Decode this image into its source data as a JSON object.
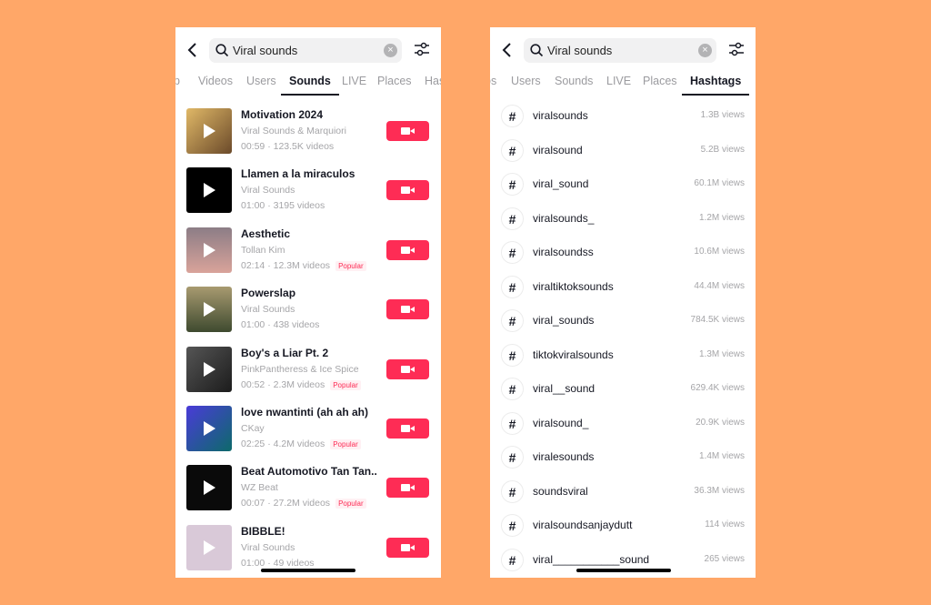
{
  "search": {
    "query": "Viral sounds"
  },
  "left": {
    "tabs": [
      {
        "label": "p"
      },
      {
        "label": "Videos"
      },
      {
        "label": "Users"
      },
      {
        "label": "Sounds",
        "active": true
      },
      {
        "label": "LIVE"
      },
      {
        "label": "Places"
      },
      {
        "label": "Has"
      }
    ],
    "sounds": [
      {
        "title": "Motivation 2024",
        "artist": "Viral Sounds & Marquiori",
        "meta": "00:59 · 123.5K videos",
        "badge": ""
      },
      {
        "title": "Llamen a la miraculos",
        "artist": "Viral Sounds",
        "meta": "01:00 · 3195 videos",
        "badge": ""
      },
      {
        "title": "Aesthetic",
        "artist": "Tollan Kim",
        "meta": "02:14 · 12.3M videos",
        "badge": "Popular"
      },
      {
        "title": "Powerslap",
        "artist": "Viral Sounds",
        "meta": "01:00 · 438 videos",
        "badge": ""
      },
      {
        "title": "Boy's a Liar Pt. 2",
        "artist": "PinkPantheress & Ice Spice",
        "meta": "00:52 · 2.3M videos",
        "badge": "Popular"
      },
      {
        "title": "love nwantinti (ah ah ah)",
        "artist": "CKay",
        "meta": "02:25 · 4.2M videos",
        "badge": "Popular"
      },
      {
        "title": "Beat Automotivo Tan Tan...",
        "artist": "WZ Beat",
        "meta": "00:07 · 27.2M videos",
        "badge": "Popular"
      },
      {
        "title": "BIBBLE!",
        "artist": "Viral Sounds",
        "meta": "01:00 · 49 videos",
        "badge": ""
      }
    ]
  },
  "right": {
    "tabs": [
      {
        "label": "os"
      },
      {
        "label": "Users"
      },
      {
        "label": "Sounds"
      },
      {
        "label": "LIVE"
      },
      {
        "label": "Places"
      },
      {
        "label": "Hashtags",
        "active": true
      }
    ],
    "hashtags": [
      {
        "name": "viralsounds",
        "views": "1.3B views"
      },
      {
        "name": "viralsound",
        "views": "5.2B views"
      },
      {
        "name": "viral_sound",
        "views": "60.1M views"
      },
      {
        "name": "viralsounds_",
        "views": "1.2M views"
      },
      {
        "name": "viralsoundss",
        "views": "10.6M views"
      },
      {
        "name": "viraltiktoksounds",
        "views": "44.4M views"
      },
      {
        "name": "viral_sounds",
        "views": "784.5K views"
      },
      {
        "name": "tiktokviralsounds",
        "views": "1.3M views"
      },
      {
        "name": "viral__sound",
        "views": "629.4K views"
      },
      {
        "name": "viralsound_",
        "views": "20.9K views"
      },
      {
        "name": "viralesounds",
        "views": "1.4M views"
      },
      {
        "name": "soundsviral",
        "views": "36.3M views"
      },
      {
        "name": "viralsoundsanjaydutt",
        "views": "114 views"
      },
      {
        "name": "viral___________sound",
        "views": "265 views"
      }
    ]
  },
  "colors": {
    "background": "#FFA768",
    "accent": "#fe2c55",
    "text": "#161823"
  }
}
